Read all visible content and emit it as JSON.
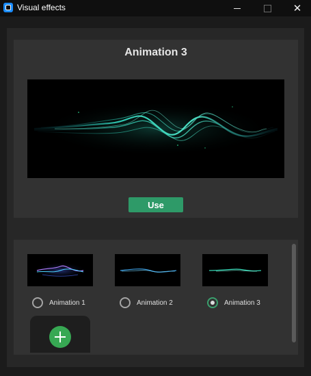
{
  "window": {
    "title": "Visual effects",
    "close_glyph": "✕"
  },
  "preview": {
    "title": "Animation 3",
    "use_label": "Use"
  },
  "gallery": {
    "items": [
      {
        "label": "Animation 1",
        "selected": false
      },
      {
        "label": "Animation 2",
        "selected": false
      },
      {
        "label": "Animation 3",
        "selected": true
      }
    ],
    "add_icon": "plus-icon"
  },
  "colors": {
    "accent_green": "#2e9a68",
    "add_green": "#37a853",
    "wave_cyan": "#3ad6b8"
  }
}
